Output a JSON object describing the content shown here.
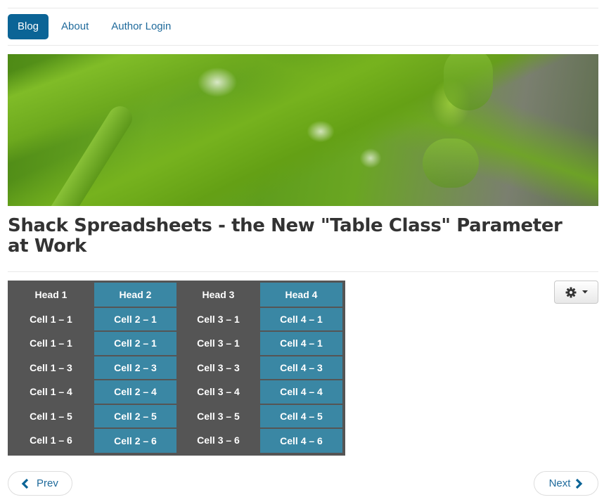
{
  "nav": {
    "items": [
      {
        "label": "Blog",
        "active": true
      },
      {
        "label": "About",
        "active": false
      },
      {
        "label": "Author Login",
        "active": false
      }
    ]
  },
  "hero": {
    "description": "Green grass blades covered with water droplets",
    "icon": "hero-image"
  },
  "article": {
    "title": "Shack Spreadsheets - the New \"Table Class\" Parameter at Work"
  },
  "tools": {
    "icon": "gear-icon",
    "caret": "caret-down-icon"
  },
  "table": {
    "headers": [
      "Head 1",
      "Head 2",
      "Head 3",
      "Head 4"
    ],
    "rows": [
      [
        "Cell 1 – 1",
        "Cell 2 – 1",
        "Cell 3 – 1",
        "Cell 4 – 1"
      ],
      [
        "Cell 1 – 1",
        "Cell 2 – 1",
        "Cell 3 – 1",
        "Cell 4 – 1"
      ],
      [
        "Cell 1 – 3",
        "Cell 2 – 3",
        "Cell 3 – 3",
        "Cell 4 – 3"
      ],
      [
        "Cell 1 – 4",
        "Cell 2 – 4",
        "Cell 3 – 4",
        "Cell 4 – 4"
      ],
      [
        "Cell 1 – 5",
        "Cell 2 – 5",
        "Cell 3 – 5",
        "Cell 4 – 5"
      ],
      [
        "Cell 1 – 6",
        "Cell 2 – 6",
        "Cell 3 – 6",
        "Cell 4 – 6"
      ]
    ],
    "colors": {
      "dark": "#555555",
      "teal": "#3a87a4",
      "text": "#ffffff"
    }
  },
  "pager": {
    "prev_label": "Prev",
    "next_label": "Next",
    "prev_icon": "chevron-left-icon",
    "next_icon": "chevron-right-icon"
  },
  "colors": {
    "link": "#1f6a9b",
    "active_nav_bg": "#0b6496"
  }
}
